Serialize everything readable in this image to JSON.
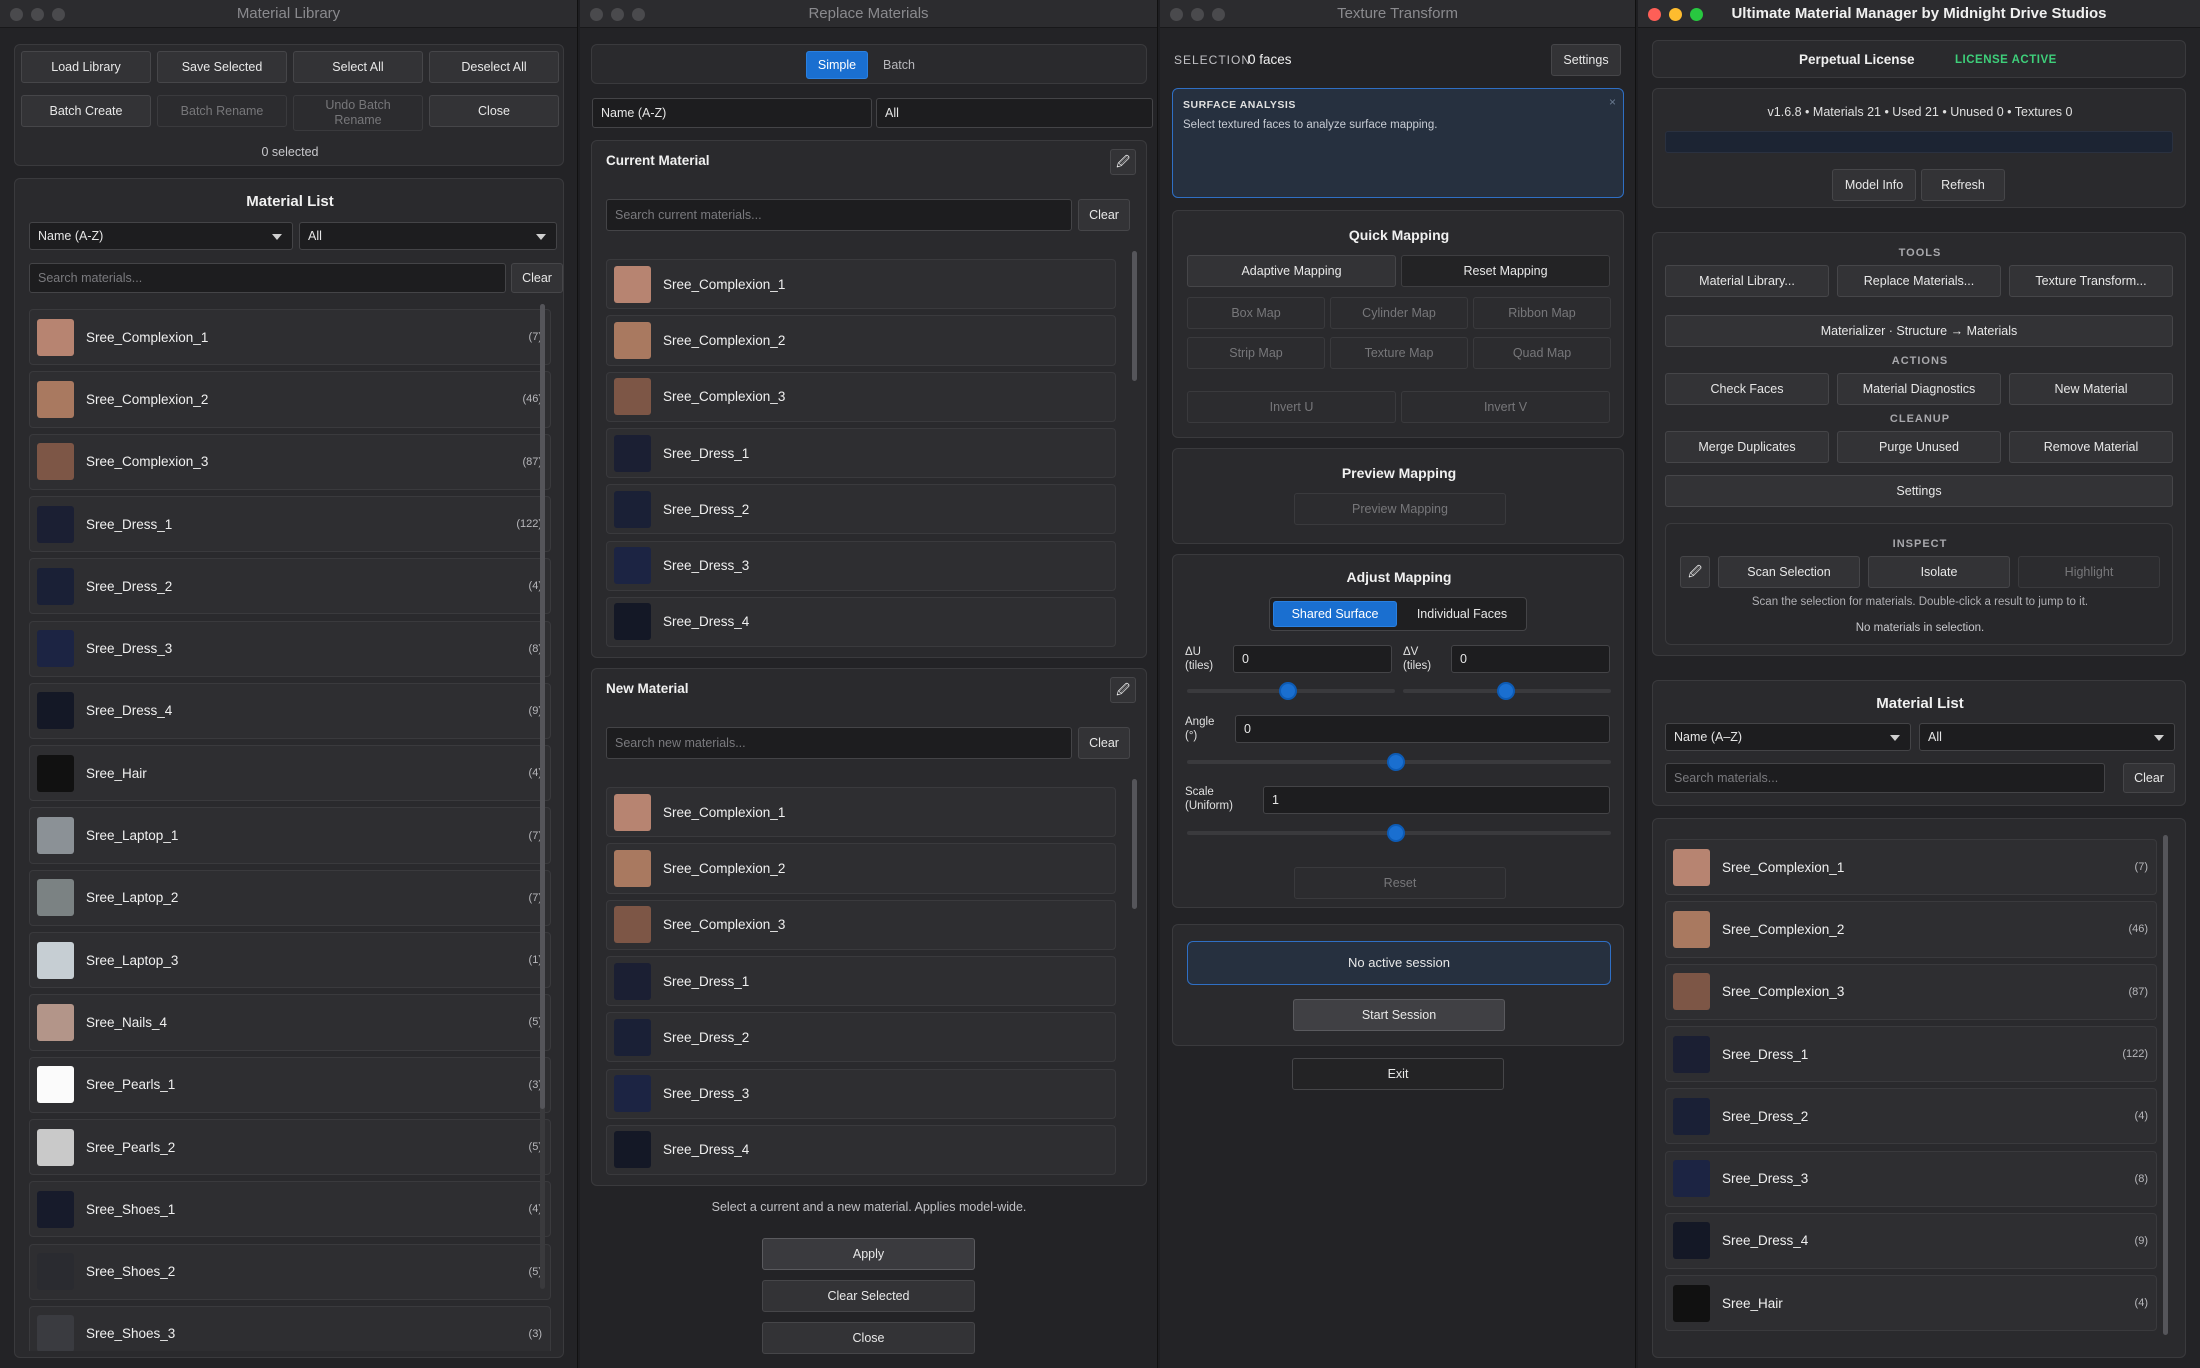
{
  "win1": {
    "title": "Material Library",
    "buttons": [
      "Load Library",
      "Save Selected",
      "Select All",
      "Deselect All",
      "Batch Create",
      "Batch Rename",
      "Undo Batch Rename",
      "Close"
    ],
    "selected_count": "0 selected",
    "list_title": "Material List",
    "sort": "Name (A-Z)",
    "filter": "All",
    "search_placeholder": "Search materials...",
    "clear": "Clear",
    "items": [
      {
        "name": "Sree_Complexion_1",
        "count": "(7)",
        "color": "#b78471"
      },
      {
        "name": "Sree_Complexion_2",
        "count": "(46)",
        "color": "#a97960"
      },
      {
        "name": "Sree_Complexion_3",
        "count": "(87)",
        "color": "#7d5646"
      },
      {
        "name": "Sree_Dress_1",
        "count": "(122)",
        "color": "#1b1f33"
      },
      {
        "name": "Sree_Dress_2",
        "count": "(4)",
        "color": "#1a2036"
      },
      {
        "name": "Sree_Dress_3",
        "count": "(8)",
        "color": "#1c2443"
      },
      {
        "name": "Sree_Dress_4",
        "count": "(9)",
        "color": "#141826"
      },
      {
        "name": "Sree_Hair",
        "count": "(4)",
        "color": "#111111"
      },
      {
        "name": "Sree_Laptop_1",
        "count": "(7)",
        "color": "#8b9196"
      },
      {
        "name": "Sree_Laptop_2",
        "count": "(7)",
        "color": "#7b8283"
      },
      {
        "name": "Sree_Laptop_3",
        "count": "(1)",
        "color": "#c6ced3"
      },
      {
        "name": "Sree_Nails_4",
        "count": "(5)",
        "color": "#b39589"
      },
      {
        "name": "Sree_Pearls_1",
        "count": "(3)",
        "color": "#fbfbfb"
      },
      {
        "name": "Sree_Pearls_2",
        "count": "(5)",
        "color": "#c9c9c9"
      },
      {
        "name": "Sree_Shoes_1",
        "count": "(4)",
        "color": "#171b2b"
      },
      {
        "name": "Sree_Shoes_2",
        "count": "(5)",
        "color": "#2a2b30"
      },
      {
        "name": "Sree_Shoes_3",
        "count": "(3)",
        "color": "#3a3b40"
      }
    ]
  },
  "win2": {
    "title": "Replace Materials",
    "tabs": [
      "Simple",
      "Batch"
    ],
    "sort": "Name (A-Z)",
    "filter": "All",
    "current_title": "Current Material",
    "current_placeholder": "Search current materials...",
    "new_title": "New Material",
    "new_placeholder": "Search new materials...",
    "clear": "Clear",
    "items": [
      {
        "name": "Sree_Complexion_1",
        "color": "#b78471"
      },
      {
        "name": "Sree_Complexion_2",
        "color": "#a97960"
      },
      {
        "name": "Sree_Complexion_3",
        "color": "#7d5646"
      },
      {
        "name": "Sree_Dress_1",
        "color": "#1b1f33"
      },
      {
        "name": "Sree_Dress_2",
        "color": "#1a2036"
      },
      {
        "name": "Sree_Dress_3",
        "color": "#1c2443"
      },
      {
        "name": "Sree_Dress_4",
        "color": "#141826"
      }
    ],
    "hint": "Select a current and a new material. Applies model-wide.",
    "apply": "Apply",
    "clear_selected": "Clear Selected",
    "close": "Close"
  },
  "win3": {
    "title": "Texture Transform",
    "selection_label": "SELECTION",
    "selection_value": "0 faces",
    "settings": "Settings",
    "analysis_title": "SURFACE ANALYSIS",
    "analysis_text": "Select textured faces to analyze surface mapping.",
    "analysis_close": "×",
    "quick_title": "Quick Mapping",
    "adaptive": "Adaptive Mapping",
    "reset_mapping": "Reset Mapping",
    "maps": [
      "Box Map",
      "Cylinder Map",
      "Ribbon Map",
      "Strip Map",
      "Texture Map",
      "Quad Map"
    ],
    "invert_u": "Invert U",
    "invert_v": "Invert V",
    "preview_title": "Preview Mapping",
    "preview_btn": "Preview Mapping",
    "adjust_title": "Adjust Mapping",
    "shared": "Shared Surface",
    "individual": "Individual Faces",
    "du_label": "ΔU (tiles)",
    "du_value": "0",
    "dv_label": "ΔV (tiles)",
    "dv_value": "0",
    "angle_label": "Angle (°)",
    "angle_value": "0",
    "scale_label": "Scale (Uniform)",
    "scale_value": "1",
    "reset": "Reset",
    "session_status": "No active session",
    "start_session": "Start Session",
    "exit": "Exit"
  },
  "win4": {
    "title": "Ultimate Material Manager by Midnight Drive Studios",
    "license": "Perpetual License",
    "license_status": "LICENSE ACTIVE",
    "stats": "v1.6.8 • Materials 21 • Used 21 • Unused 0 • Textures 0",
    "model_info": "Model Info",
    "refresh": "Refresh",
    "tools_label": "TOOLS",
    "tools": [
      "Material Library...",
      "Replace Materials...",
      "Texture Transform..."
    ],
    "materializer": "Materializer · Structure → Materials",
    "actions_label": "ACTIONS",
    "actions": [
      "Check Faces",
      "Material Diagnostics",
      "New Material"
    ],
    "cleanup_label": "CLEANUP",
    "cleanup": [
      "Merge Duplicates",
      "Purge Unused",
      "Remove Material"
    ],
    "settings": "Settings",
    "inspect_label": "INSPECT",
    "inspect": [
      "Scan Selection",
      "Isolate",
      "Highlight"
    ],
    "inspect_hint": "Scan the selection for materials. Double-click a result to jump to it.",
    "inspect_empty": "No materials in selection.",
    "list_title": "Material List",
    "sort": "Name (A–Z)",
    "filter": "All",
    "search_placeholder": "Search materials...",
    "clear": "Clear",
    "items": [
      {
        "name": "Sree_Complexion_1",
        "count": "(7)",
        "color": "#b78471"
      },
      {
        "name": "Sree_Complexion_2",
        "count": "(46)",
        "color": "#a97960"
      },
      {
        "name": "Sree_Complexion_3",
        "count": "(87)",
        "color": "#7d5646"
      },
      {
        "name": "Sree_Dress_1",
        "count": "(122)",
        "color": "#1b1f33"
      },
      {
        "name": "Sree_Dress_2",
        "count": "(4)",
        "color": "#1a2036"
      },
      {
        "name": "Sree_Dress_3",
        "count": "(8)",
        "color": "#1c2443"
      },
      {
        "name": "Sree_Dress_4",
        "count": "(9)",
        "color": "#141826"
      },
      {
        "name": "Sree_Hair",
        "count": "(4)",
        "color": "#111111"
      }
    ]
  }
}
